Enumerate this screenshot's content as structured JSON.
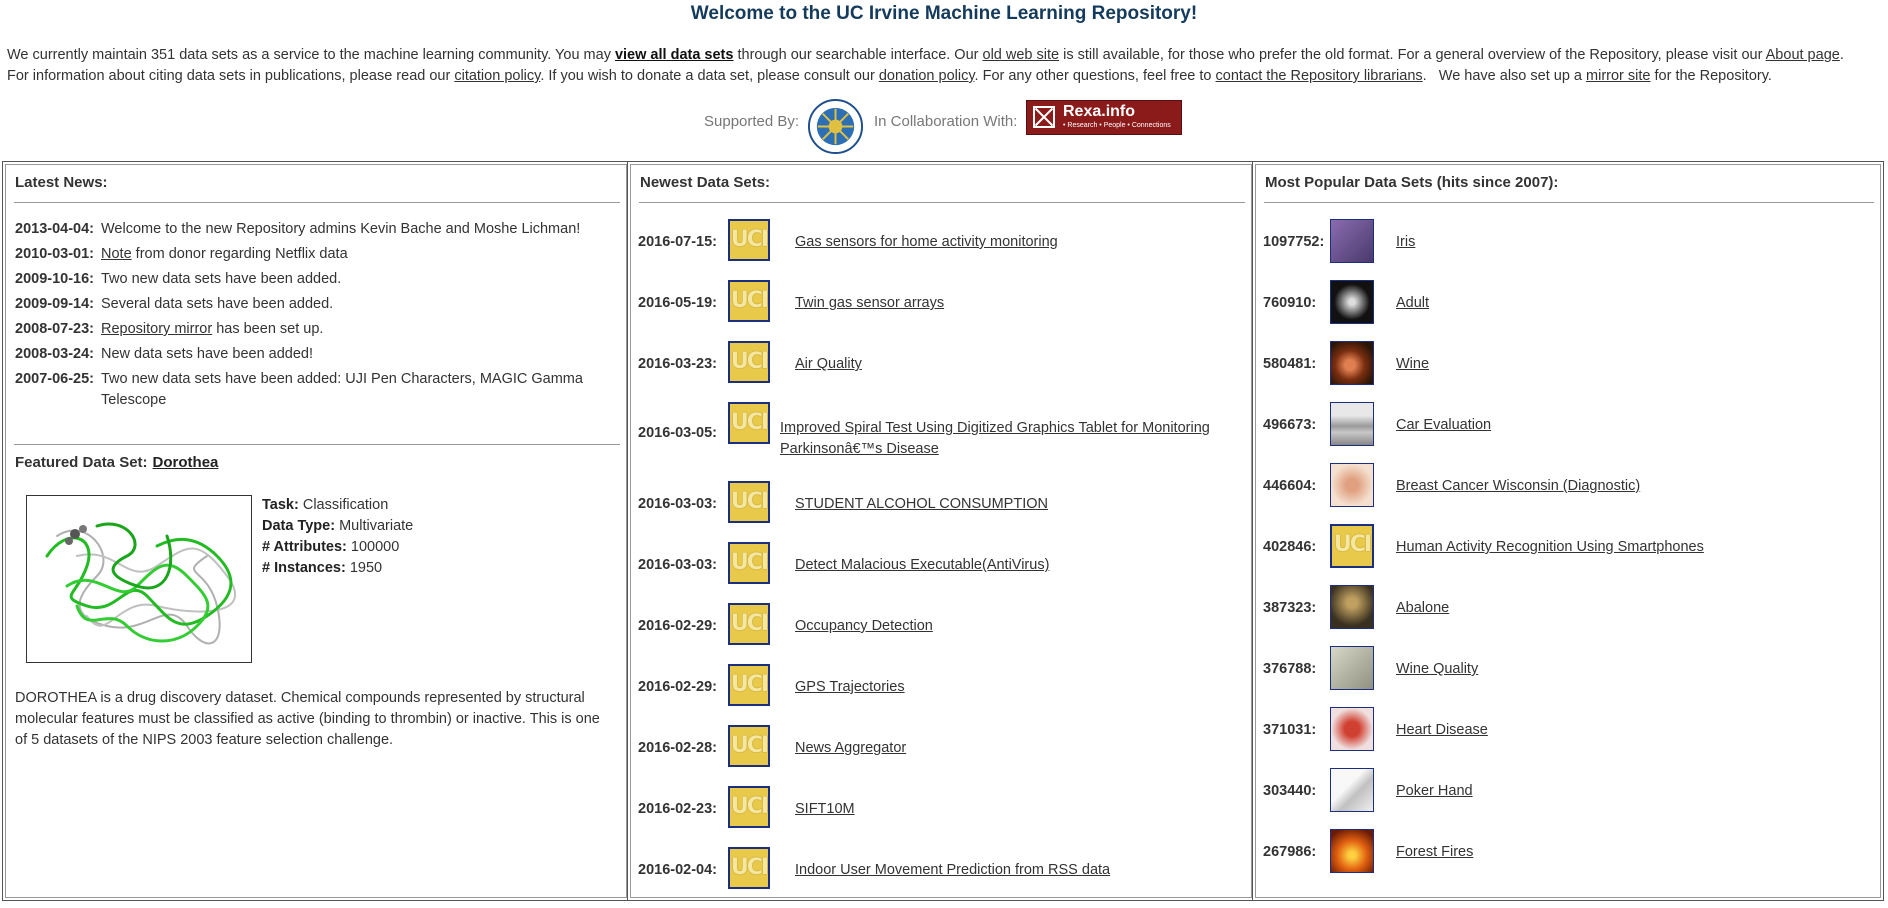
{
  "page": {
    "title": "Welcome to the UC Irvine Machine Learning Repository!",
    "intro_line1_part1": "We currently maintain 351 data sets as a service to the machine learning community. You may ",
    "intro_line1_link1": "view all data sets",
    "intro_line1_part2": " through our searchable interface. Our ",
    "intro_line1_link2": "old web site",
    "intro_line1_part3": " is still available, for those who prefer the old format. For a general overview of the Repository, please visit our ",
    "intro_line1_link3": "About page",
    "intro_line1_part4": ".",
    "intro_line2_part1": "For information about citing data sets in publications, please read our ",
    "intro_line2_link1": "citation policy",
    "intro_line2_part2": ". If you wish to donate a data set, please consult our ",
    "intro_line2_link2": "donation policy",
    "intro_line2_part3": ". For any other questions, feel free to ",
    "intro_line2_link3": "contact the Repository librarians",
    "intro_line2_part4": ".   We have also set up a ",
    "intro_line2_link4": "mirror site",
    "intro_line2_part5": " for the Repository.",
    "supported_by": "Supported By:",
    "collab_with": "In Collaboration With:",
    "rexa_name": "Rexa.info",
    "rexa_tag": "• Research • People • Connections"
  },
  "news": {
    "header": "Latest News:",
    "items": [
      {
        "date": "2013-04-04:",
        "text": "Welcome to the new Repository admins Kevin Bache and Moshe Lichman!"
      },
      {
        "date": "2010-03-01:",
        "link": "Note",
        "text": " from donor regarding Netflix data"
      },
      {
        "date": "2009-10-16:",
        "text": "Two new data sets have been added."
      },
      {
        "date": "2009-09-14:",
        "text": "Several data sets have been added."
      },
      {
        "date": "2008-07-23:",
        "link": "Repository mirror",
        "text": " has been set up."
      },
      {
        "date": "2008-03-24:",
        "text": "New data sets have been added!"
      },
      {
        "date": "2007-06-25:",
        "text": "Two new data sets have been added: UJI Pen Characters, MAGIC Gamma Telescope"
      }
    ]
  },
  "featured": {
    "label": "Featured Data Set:",
    "name": "Dorothea",
    "task_label": "Task:",
    "task": " Classification",
    "type_label": "Data Type:",
    "type": " Multivariate",
    "attr_label": "# Attributes:",
    "attr": " 100000",
    "inst_label": "# Instances:",
    "inst": " 1950",
    "description": "DOROTHEA is a drug discovery dataset. Chemical compounds represented by structural molecular features must be classified as active (binding to thrombin) or inactive. This is one of 5 datasets of the NIPS 2003 feature selection challenge."
  },
  "newest": {
    "header": "Newest Data Sets:",
    "icon_text": "UCI",
    "items": [
      {
        "date": "2016-07-15:",
        "name": "Gas sensors for home activity monitoring"
      },
      {
        "date": "2016-05-19:",
        "name": "Twin gas sensor arrays"
      },
      {
        "date": "2016-03-23:",
        "name": "Air Quality"
      },
      {
        "date": "2016-03-05:",
        "name": "Improved Spiral Test Using Digitized Graphics Tablet for Monitoring Parkinsonâ€™s Disease"
      },
      {
        "date": "2016-03-03:",
        "name": "STUDENT ALCOHOL CONSUMPTION"
      },
      {
        "date": "2016-03-03:",
        "name": "Detect Malacious Executable(AntiVirus)"
      },
      {
        "date": "2016-02-29:",
        "name": "Occupancy Detection"
      },
      {
        "date": "2016-02-29:",
        "name": "GPS Trajectories"
      },
      {
        "date": "2016-02-28:",
        "name": "News Aggregator"
      },
      {
        "date": "2016-02-23:",
        "name": "SIFT10M"
      },
      {
        "date": "2016-02-04:",
        "name": "Indoor User Movement Prediction from RSS data"
      }
    ]
  },
  "popular": {
    "header": "Most Popular Data Sets (hits since 2007):",
    "items": [
      {
        "hits": "1097752:",
        "name": "Iris",
        "thumb": "#6a4c8c"
      },
      {
        "hits": "760910:",
        "name": "Adult",
        "thumb": "#2a2a2a"
      },
      {
        "hits": "580481:",
        "name": "Wine",
        "thumb": "#7a2e10"
      },
      {
        "hits": "496673:",
        "name": "Car Evaluation",
        "thumb": "#a0a0a0"
      },
      {
        "hits": "446604:",
        "name": "Breast Cancer Wisconsin (Diagnostic)",
        "thumb": "#d09070"
      },
      {
        "hits": "402846:",
        "name": "Human Activity Recognition Using Smartphones",
        "thumb": "uci"
      },
      {
        "hits": "387323:",
        "name": "Abalone",
        "thumb": "#5a4a20"
      },
      {
        "hits": "376788:",
        "name": "Wine Quality",
        "thumb": "#b0b0a0"
      },
      {
        "hits": "371031:",
        "name": "Heart Disease",
        "thumb": "#c04030"
      },
      {
        "hits": "303440:",
        "name": "Poker Hand",
        "thumb": "#e0e0e0"
      },
      {
        "hits": "267986:",
        "name": "Forest Fires",
        "thumb": "#d06010"
      }
    ]
  }
}
